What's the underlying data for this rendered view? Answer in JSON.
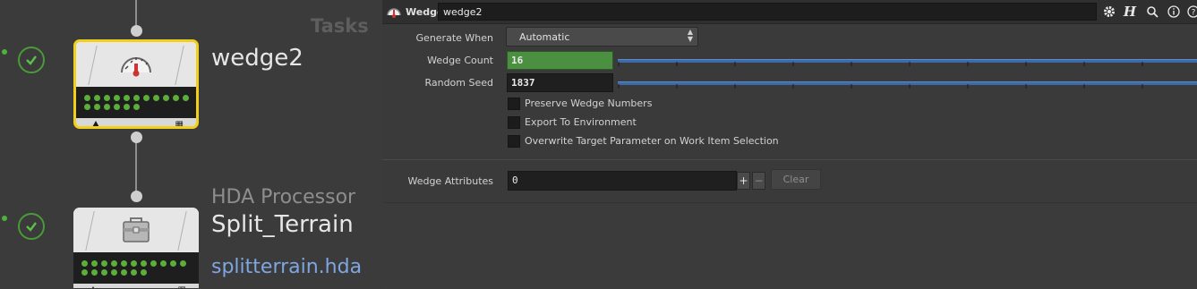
{
  "network": {
    "section_label": "Tasks",
    "nodes": [
      {
        "title": "wedge2",
        "type_label": "",
        "extra_label": ""
      },
      {
        "title": "Split_Terrain",
        "type_label": "HDA Processor",
        "extra_label": "splitterrain.hda"
      }
    ]
  },
  "params": {
    "node_type": "Wedge",
    "node_name": "wedge2",
    "generate_when": {
      "label": "Generate When",
      "value": "Automatic"
    },
    "wedge_count": {
      "label": "Wedge Count",
      "value": "16"
    },
    "random_seed": {
      "label": "Random Seed",
      "value": "1837"
    },
    "checkboxes": [
      "Preserve Wedge Numbers",
      "Export To Environment",
      "Overwrite Target Parameter on Work Item Selection"
    ],
    "wedge_attributes": {
      "label": "Wedge Attributes",
      "value": "0",
      "add": "+",
      "remove": "−",
      "clear": "Clear"
    },
    "toolbar_icons": [
      "gear-icon",
      "help-h-icon",
      "search-icon",
      "info-icon",
      "question-icon"
    ]
  },
  "colors": {
    "selected_outline": "#f2cf1a",
    "status_green": "#5cae3a",
    "slider_blue": "#3d6ba8",
    "wedge_count_field": "#4b8f40",
    "link_blue": "#7fa6e0"
  }
}
